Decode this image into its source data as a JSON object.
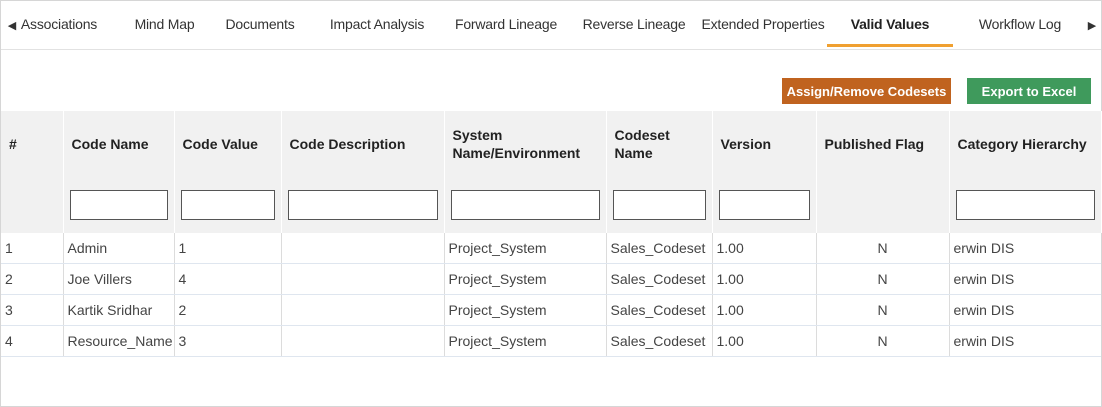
{
  "tabs": [
    {
      "label": "Associations",
      "active": false
    },
    {
      "label": "Mind Map",
      "active": false
    },
    {
      "label": "Documents",
      "active": false
    },
    {
      "label": "Impact Analysis",
      "active": false
    },
    {
      "label": "Forward Lineage",
      "active": false
    },
    {
      "label": "Reverse Lineage",
      "active": false
    },
    {
      "label": "Extended Properties",
      "active": false
    },
    {
      "label": "Valid Values",
      "active": true
    },
    {
      "label": "Workflow Log",
      "active": false
    }
  ],
  "toolbar": {
    "assign_label": "Assign/Remove Codesets",
    "export_label": "Export to Excel"
  },
  "grid": {
    "columns": [
      "#",
      "Code Name",
      "Code Value",
      "Code Description",
      "System Name/Environment",
      "Codeset Name",
      "Version",
      "Published Flag",
      "Category Hierarchy"
    ],
    "rows": [
      [
        "1",
        "Admin",
        "1",
        "",
        "Project_System",
        "Sales_Codeset",
        "1.00",
        "N",
        "erwin DIS"
      ],
      [
        "2",
        "Joe Villers",
        "4",
        "",
        "Project_System",
        "Sales_Codeset",
        "1.00",
        "N",
        "erwin DIS"
      ],
      [
        "3",
        "Kartik Sridhar",
        "2",
        "",
        "Project_System",
        "Sales_Codeset",
        "1.00",
        "N",
        "erwin DIS"
      ],
      [
        "4",
        "Resource_Name",
        "3",
        "",
        "Project_System",
        "Sales_Codeset",
        "1.00",
        "N",
        "erwin DIS"
      ]
    ]
  },
  "colors": {
    "active_tab_underline": "#f0a030",
    "assign_button": "#c0631f",
    "export_button": "#3f9a5c"
  }
}
